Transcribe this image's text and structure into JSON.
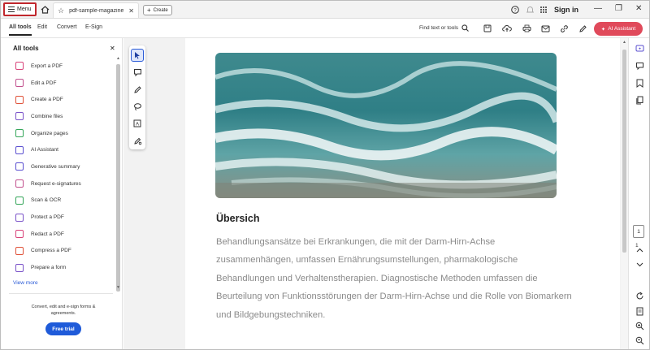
{
  "titlebar": {
    "menu_label": "Menu",
    "tab_title": "pdf-sample-magazine-3...",
    "create_label": "Create",
    "signin_label": "Sign in"
  },
  "toolbar": {
    "tabs": [
      "All tools",
      "Edit",
      "Convert",
      "E-Sign"
    ],
    "find_label": "Find text or tools",
    "ai_label": "AI Assistant"
  },
  "panel": {
    "title": "All tools",
    "items": [
      {
        "label": "Export a PDF",
        "color": "#d8437a"
      },
      {
        "label": "Edit a PDF",
        "color": "#c2518e"
      },
      {
        "label": "Create a PDF",
        "color": "#e0533a"
      },
      {
        "label": "Combine files",
        "color": "#7b53c9"
      },
      {
        "label": "Organize pages",
        "color": "#35a65a"
      },
      {
        "label": "AI Assistant",
        "color": "#5a4fd0"
      },
      {
        "label": "Generative summary",
        "color": "#5a4fd0"
      },
      {
        "label": "Request e-signatures",
        "color": "#c2518e"
      },
      {
        "label": "Scan & OCR",
        "color": "#35a65a"
      },
      {
        "label": "Protect a PDF",
        "color": "#7b53c9"
      },
      {
        "label": "Redact a PDF",
        "color": "#d8437a"
      },
      {
        "label": "Compress a PDF",
        "color": "#e0533a"
      },
      {
        "label": "Prepare a form",
        "color": "#7b53c9"
      }
    ],
    "view_more": "View more",
    "promo_text": "Convert, edit and e-sign forms & agreements.",
    "trial_label": "Free trial"
  },
  "document": {
    "heading": "Übersich",
    "body": "Behandlungsansätze bei Erkrankungen, die mit der Darm-Hirn-Achse zusammenhängen, umfassen Ernährungsumstellungen, pharmakologische Behandlungen und Verhaltenstherapien. Diagnostische Methoden umfassen die Beurteilung von Funktionsstörungen der Darm-Hirn-Achse und die Rolle von Biomarkern und Bildgebungstechniken."
  },
  "pager": {
    "current": "1",
    "total": "1"
  },
  "colors": {
    "accent_blue": "#1f5bd9",
    "ai_red": "#e04a5b",
    "menu_border": "#c1272d"
  }
}
